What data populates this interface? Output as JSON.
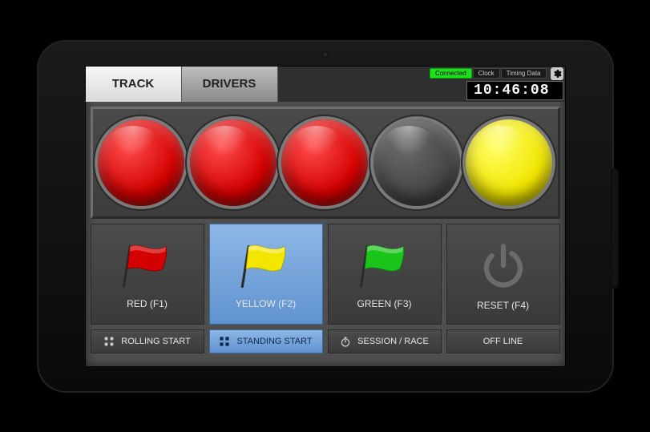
{
  "tabs": {
    "track": "TRACK",
    "drivers": "DRIVERS"
  },
  "status": {
    "connected": "Connected",
    "clock_label": "Clock",
    "timing_label": "Timing Data",
    "time": "10:46:08"
  },
  "lights": [
    {
      "state": "red"
    },
    {
      "state": "red"
    },
    {
      "state": "red"
    },
    {
      "state": "off"
    },
    {
      "state": "yellow"
    }
  ],
  "flags": {
    "red": {
      "label": "RED (F1)",
      "color": "#d40000"
    },
    "yellow": {
      "label": "YELLOW (F2)",
      "color": "#f2e600"
    },
    "green": {
      "label": "GREEN (F3)",
      "color": "#1bc41b"
    },
    "reset": {
      "label": "RESET (F4)"
    }
  },
  "bottom": {
    "rolling": "ROLLING START",
    "standing": "STANDING START",
    "session": "SESSION / RACE",
    "offline": "OFF LINE"
  }
}
